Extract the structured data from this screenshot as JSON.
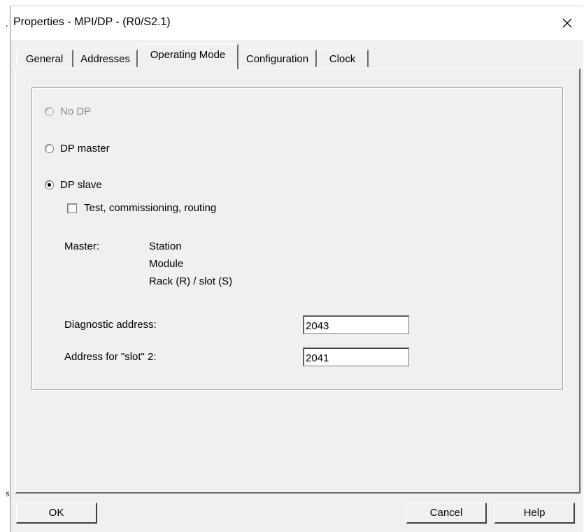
{
  "backdrop": {
    "mark_top": ",",
    "mark_bottom": "s"
  },
  "window": {
    "title": "Properties - MPI/DP - (R0/S2.1)",
    "close_glyph": "✕"
  },
  "tabs": [
    {
      "label": "General"
    },
    {
      "label": "Addresses"
    },
    {
      "label": "Operating Mode",
      "active": true
    },
    {
      "label": "Configuration"
    },
    {
      "label": "Clock"
    }
  ],
  "operating_mode": {
    "options": {
      "no_dp": {
        "label": "No DP",
        "enabled": false,
        "selected": false
      },
      "dp_master": {
        "label": "DP master",
        "enabled": true,
        "selected": false
      },
      "dp_slave": {
        "label": "DP slave",
        "enabled": true,
        "selected": true
      }
    },
    "test_commissioning": {
      "label": "Test, commissioning, routing",
      "checked": false
    },
    "master": {
      "label": "Master:",
      "station": "Station",
      "module": "Module",
      "rack_slot": "Rack (R) / slot (S)"
    },
    "diagnostic_address": {
      "label": "Diagnostic address:",
      "value": "2043"
    },
    "slot2_address": {
      "label": "Address for \"slot\" 2:",
      "value": "2041"
    }
  },
  "buttons": {
    "ok": "OK",
    "cancel": "Cancel",
    "help": "Help"
  }
}
